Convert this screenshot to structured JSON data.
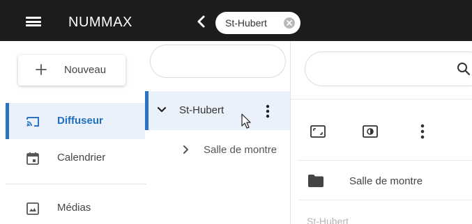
{
  "topbar": {
    "brand": "NUMMAX",
    "menu_icon": "hamburger-menu-icon",
    "back_icon": "chevron-left-icon",
    "chip": {
      "label": "St-Hubert",
      "close_icon": "close-circle-icon"
    },
    "background": "#1c1c1c"
  },
  "sidebar": {
    "new_button": {
      "label": "Nouveau",
      "icon": "plus-icon"
    },
    "items": [
      {
        "label": "Diffuseur",
        "icon": "cast-icon",
        "active": true
      },
      {
        "label": "Calendrier",
        "icon": "calendar-icon",
        "active": false
      },
      {
        "label": "Médias",
        "icon": "image-icon",
        "active": false
      }
    ],
    "accent": "#2a73c2",
    "active_background": "#eaf1fb"
  },
  "tree": {
    "search": {
      "placeholder": ""
    },
    "selected_node": {
      "label": "St-Hubert",
      "expanded": true
    },
    "children": [
      {
        "label": "Salle de montre",
        "expanded": false
      }
    ]
  },
  "detail": {
    "search": {
      "placeholder": ""
    },
    "search_icon": "search-icon",
    "toolbar": [
      "expand-icon",
      "brightness-icon",
      "more-vert-icon"
    ],
    "folder": {
      "label": "Salle de montre",
      "icon": "folder-icon"
    },
    "footer_label": "St-Hubert"
  }
}
